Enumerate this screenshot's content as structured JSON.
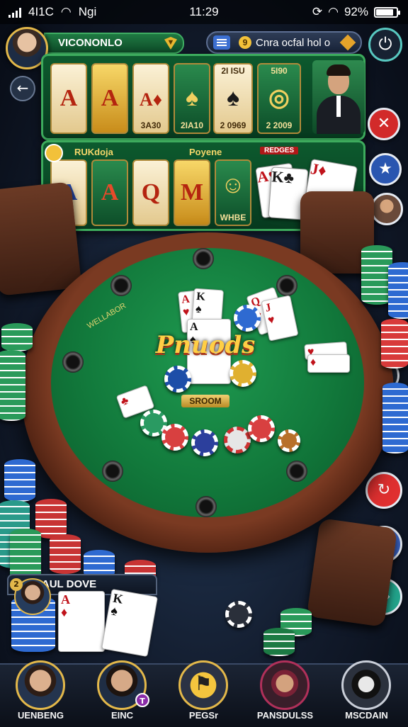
{
  "status": {
    "left_text": "4I1C",
    "network": "Ngi",
    "time": "11:29",
    "battery": "92%",
    "battery_level": 0.92
  },
  "header": {
    "player_name": "VICONONLO",
    "info_text": "Cnra ocfal hol o",
    "coin_value": "9"
  },
  "slots_top": {
    "reels": [
      {
        "symbol": "A",
        "caption": ""
      },
      {
        "symbol": "A",
        "caption": ""
      },
      {
        "symbol": "A♦",
        "caption": "3A30"
      },
      {
        "symbol": "♠",
        "caption": "2IA10"
      },
      {
        "symbol": "♠",
        "caption": "2 0969",
        "header": "2I ISU"
      },
      {
        "symbol": "◎",
        "caption": "2 2009",
        "header": "5I90"
      }
    ]
  },
  "slots_bottom": {
    "label_left": "RUKdoja",
    "label_right": "Poyene",
    "tag": "REDGES",
    "reels": [
      {
        "symbol": "A"
      },
      {
        "symbol": "A"
      },
      {
        "symbol": "Q"
      },
      {
        "symbol": "M"
      },
      {
        "symbol": "☺",
        "caption": "WHBE"
      }
    ]
  },
  "table": {
    "logo": "Pnuods",
    "pot_label": "SROOM",
    "side_text": "WELLABOR"
  },
  "player": {
    "name": "PAUL DOVE",
    "badge": "2"
  },
  "bottom_nav": [
    {
      "label": "UENBENG",
      "badge": ""
    },
    {
      "label": "EINC",
      "badge": "T"
    },
    {
      "label": "PEGSr",
      "badge": ""
    },
    {
      "label": "PANSDULSS",
      "badge": ""
    },
    {
      "label": "MSCDAIN",
      "badge": ""
    }
  ],
  "colors": {
    "felt": "#127a3c",
    "rail": "#7a3a22",
    "accent_gold": "#e3b84a",
    "panel_green": "#0d5a2e"
  }
}
